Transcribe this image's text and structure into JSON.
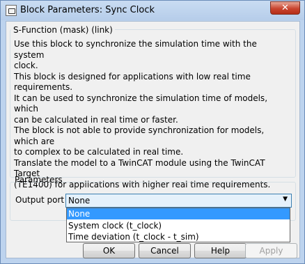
{
  "window": {
    "title": "Block Parameters: Sync Clock",
    "close_glyph": "✕"
  },
  "mask": {
    "group_title": "S-Function (mask) (link)",
    "description": "Use this block to synchronize the simulation time with the system\nclock.\nThis block is designed for applications with low real time\nrequirements.\nIt can be used to synchronize the simulation time of models, which\ncan be calculated in real time or faster.\nThe block is not able to provide synchronization for models, which are\nto complex to be calculated in real time.\nTranslate the model to a TwinCAT module using the TwinCAT Target\n(TE1400) for applications with higher real time requirements."
  },
  "parameters": {
    "group_title": "Parameters",
    "output_port_label": "Output port",
    "output_port_value": "None",
    "options": [
      "None",
      "System clock (t_clock)",
      "Time deviation (t_clock - t_sim)"
    ],
    "selected_index": 0
  },
  "buttons": {
    "ok": "OK",
    "cancel": "Cancel",
    "help": "Help",
    "apply": "Apply"
  }
}
